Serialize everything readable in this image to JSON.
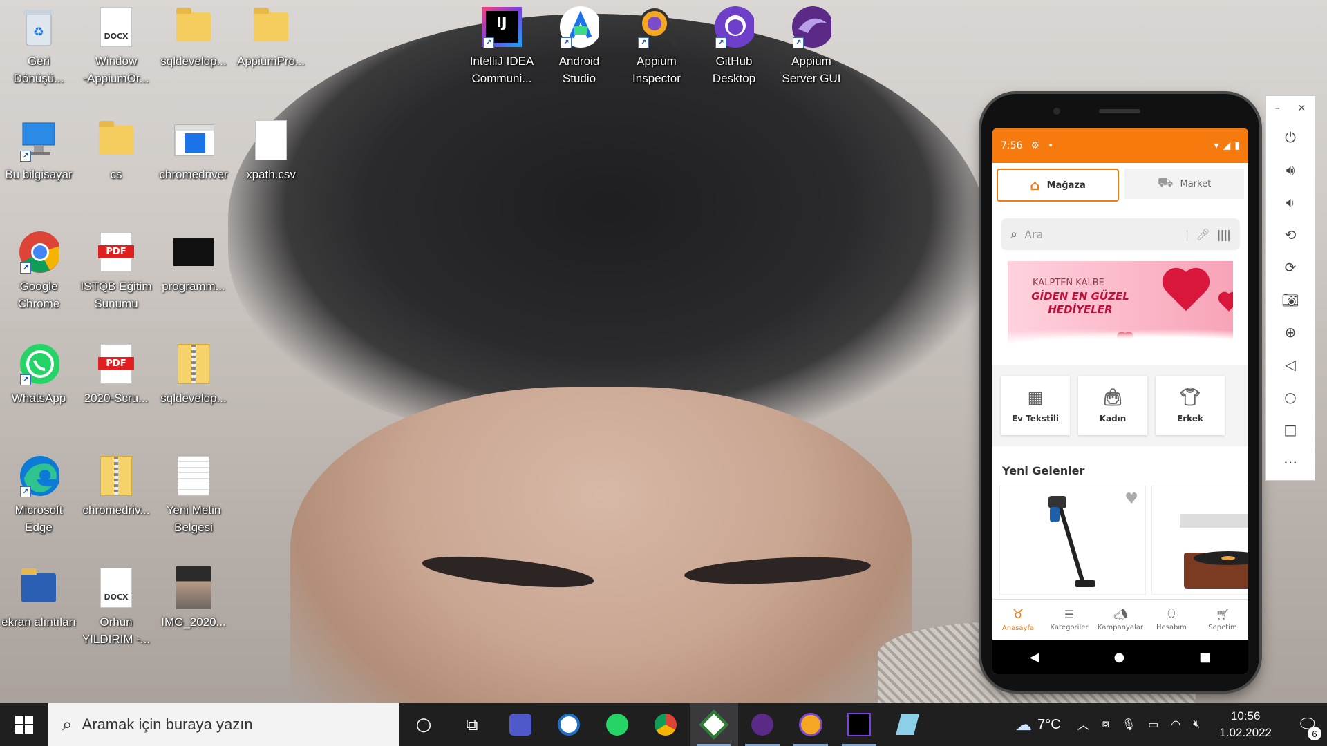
{
  "desktop": {
    "icons": [
      {
        "label": "Geri\nDönüşü...",
        "kind": "recycle-bin"
      },
      {
        "label": "Window\n-AppiumOr...",
        "kind": "docx"
      },
      {
        "label": "sqldevelop...",
        "kind": "folder"
      },
      {
        "label": "AppiumPro...",
        "kind": "folder"
      },
      {
        "label": "IntelliJ IDEA\nCommuni...",
        "kind": "intellij"
      },
      {
        "label": "Android\nStudio",
        "kind": "android-studio"
      },
      {
        "label": "Appium\nInspector",
        "kind": "appium-inspector"
      },
      {
        "label": "GitHub\nDesktop",
        "kind": "github"
      },
      {
        "label": "Appium\nServer GUI",
        "kind": "appium-server"
      },
      {
        "label": "Bu bilgisayar",
        "kind": "computer"
      },
      {
        "label": "cs",
        "kind": "folder"
      },
      {
        "label": "chromedriver",
        "kind": "exe"
      },
      {
        "label": "xpath.csv",
        "kind": "file"
      },
      {
        "label": "Google\nChrome",
        "kind": "chrome"
      },
      {
        "label": "ISTQB Eğitim\nSunumu",
        "kind": "pdf"
      },
      {
        "label": "programm...",
        "kind": "image"
      },
      {
        "label": "WhatsApp",
        "kind": "whatsapp"
      },
      {
        "label": "2020-Scru...",
        "kind": "pdf"
      },
      {
        "label": "sqldevelop...",
        "kind": "zip"
      },
      {
        "label": "Microsoft\nEdge",
        "kind": "edge"
      },
      {
        "label": "chromedriv...",
        "kind": "zip"
      },
      {
        "label": "Yeni Metin\nBelgesi",
        "kind": "txt"
      },
      {
        "label": "ekran alıntıları",
        "kind": "folder-blue"
      },
      {
        "label": "Orhun\nYILDIRIM -...",
        "kind": "docx"
      },
      {
        "label": "IMG_2020...",
        "kind": "photo"
      }
    ],
    "docx_tag": "DOCX",
    "pdf_tag": "PDF",
    "ij_tag": "IJ"
  },
  "phone": {
    "status": {
      "time": "7:56"
    },
    "segments": {
      "store": "Mağaza",
      "market": "Market"
    },
    "search_placeholder": "Ara",
    "banner": {
      "line1": "KALPTEN KALBE",
      "line2": "GİDEN EN GÜZEL HEDİYELER"
    },
    "categories": [
      "Ev Tekstili",
      "Kadın",
      "Erkek"
    ],
    "section_title": "Yeni Gelenler",
    "bottom_nav": [
      "Anasayfa",
      "Kategoriler",
      "Kampanyalar",
      "Hesabım",
      "Sepetim"
    ]
  },
  "taskbar": {
    "search_placeholder": "Aramak için buraya yazın",
    "weather": "7°C",
    "time": "10:56",
    "date": "1.02.2022",
    "notifications": "6"
  },
  "colors": {
    "accent": "#f77a0f"
  }
}
